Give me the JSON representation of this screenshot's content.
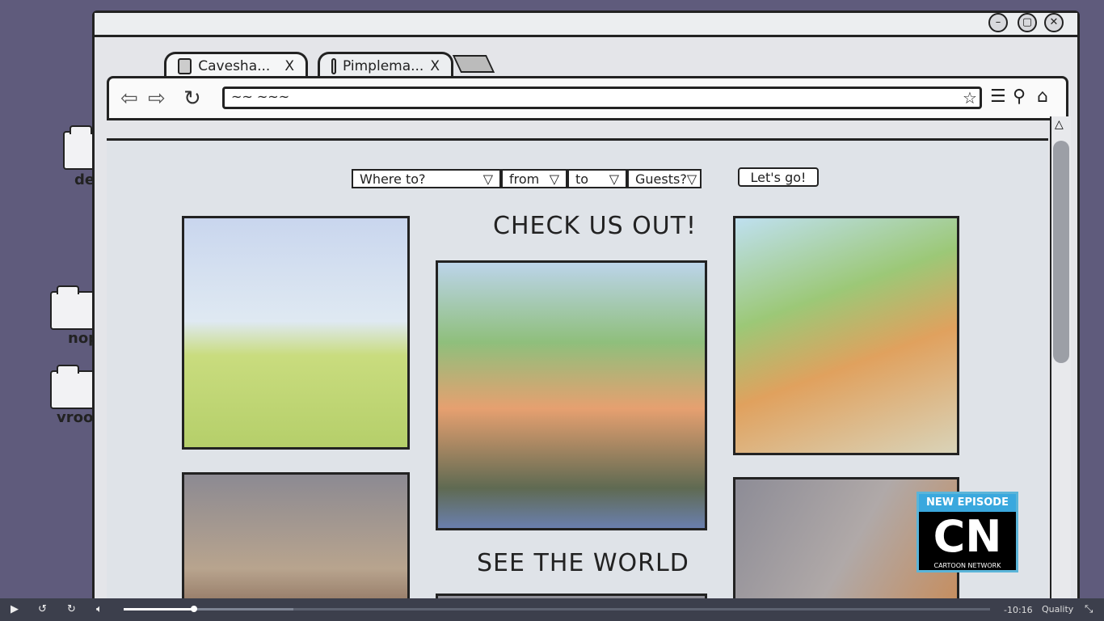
{
  "desktop": {
    "icons": [
      {
        "label": "de"
      },
      {
        "label": "nop"
      },
      {
        "label": "vroo"
      }
    ]
  },
  "browser": {
    "tabs": [
      {
        "label": "Cavesha...",
        "close": "X",
        "active": true
      },
      {
        "label": "Pimplema...",
        "close": "X",
        "active": false
      }
    ],
    "url_text": "~~ ~~~",
    "window_buttons": {
      "minimize": "–",
      "maximize": "▢",
      "close": "✕"
    }
  },
  "page": {
    "search": {
      "where": "Where to?",
      "from": "from",
      "to": "to",
      "guests": "Guests?",
      "go_label": "Let's go!"
    },
    "heading1": "CHECK US OUT!",
    "heading2": "SEE THE WORLD"
  },
  "overlay": {
    "badge": "NEW EPISODE",
    "logo": "CN",
    "network": "CARTOON NETWORK"
  },
  "player": {
    "time_remaining": "-10:16",
    "quality_label": "Quality",
    "played_fraction": 0.081,
    "buffered_fraction": 0.196
  }
}
